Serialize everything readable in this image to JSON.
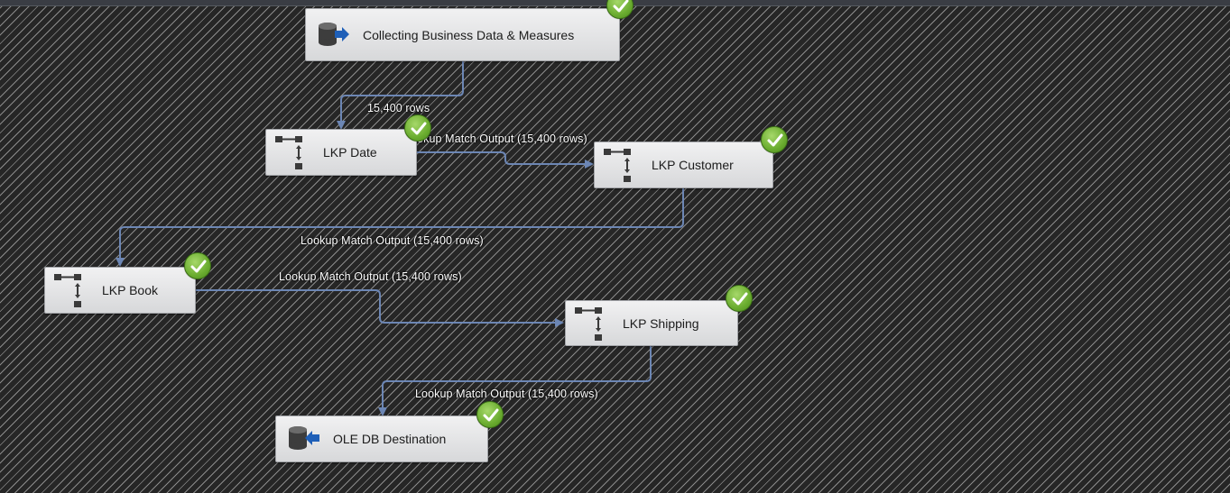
{
  "nodes": {
    "source": {
      "label": "Collecting Business Data & Measures",
      "icon": "ole-db-source-icon",
      "status": "success"
    },
    "lkp_date": {
      "label": "LKP Date",
      "icon": "lookup-icon",
      "status": "success"
    },
    "lkp_customer": {
      "label": "LKP Customer",
      "icon": "lookup-icon",
      "status": "success"
    },
    "lkp_book": {
      "label": "LKP Book",
      "icon": "lookup-icon",
      "status": "success"
    },
    "lkp_shipping": {
      "label": "LKP Shipping",
      "icon": "lookup-icon",
      "status": "success"
    },
    "destination": {
      "label": "OLE DB Destination",
      "icon": "ole-db-destination-icon",
      "status": "success"
    }
  },
  "flows": {
    "source_to_date": "15,400 rows",
    "date_to_customer": "Lookup Match Output (15,400 rows)",
    "customer_to_book": "Lookup Match Output (15,400 rows)",
    "book_to_shipping": "Lookup Match Output (15,400 rows)",
    "shipping_to_destination": "Lookup Match Output (15,400 rows)"
  },
  "colors": {
    "canvas_background": "#262626",
    "hatch": "#8a8a8a",
    "connector": "#6c86b4",
    "task_fill": "#e4e5e7",
    "success_check": "#6aac2f"
  }
}
